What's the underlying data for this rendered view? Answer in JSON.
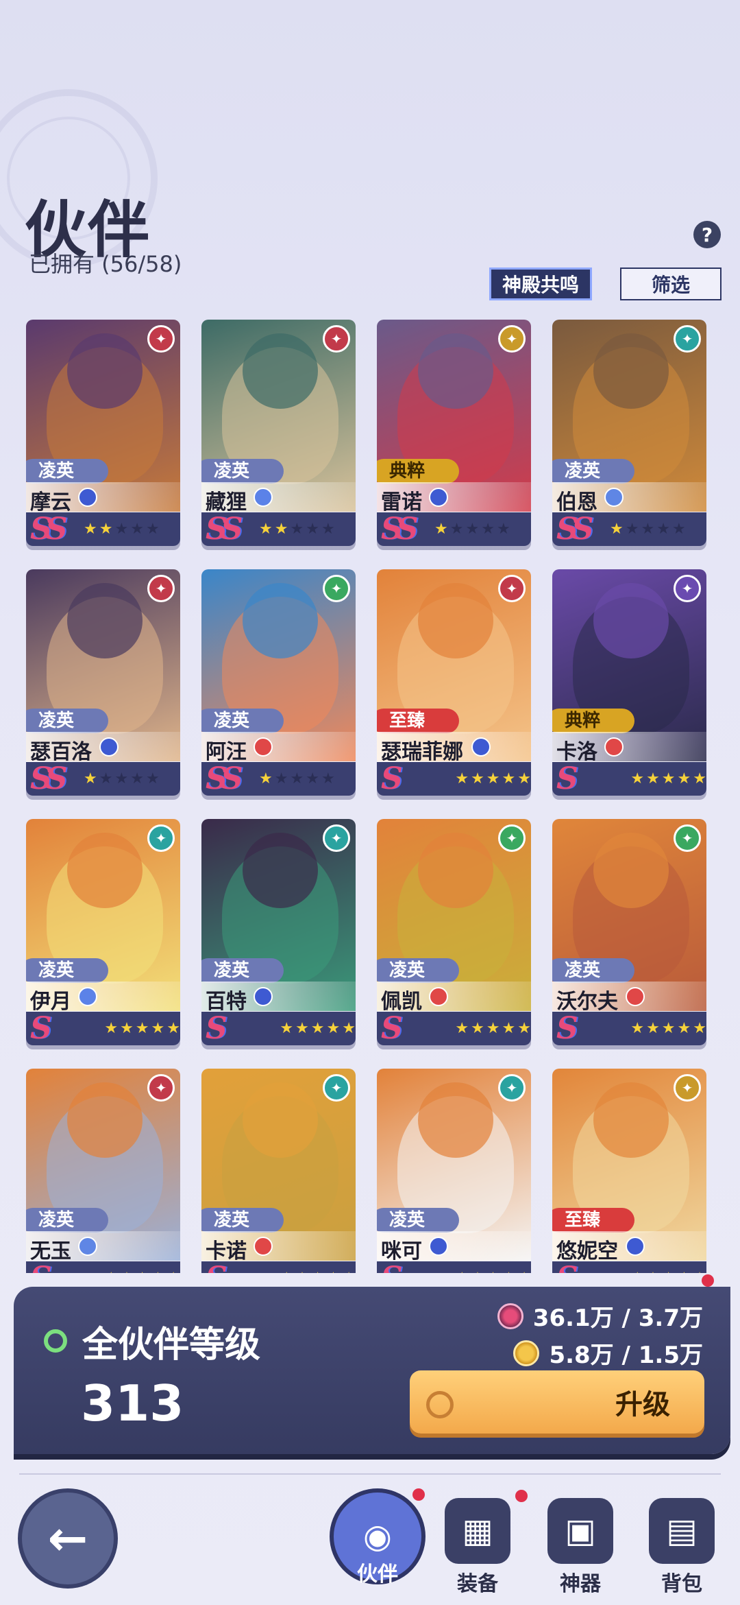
{
  "header": {
    "title": "伙伴",
    "owned_label": "已拥有 (56/58)",
    "help": "?",
    "resonance_button": "神殿共鸣",
    "filter_button": "筛选"
  },
  "partners": [
    {
      "name": "摩云",
      "rarity": "凌英",
      "rarity_class": "r1",
      "grade": "SS",
      "stars": 2,
      "art": [
        "#5a3a6e",
        "#c77a3a"
      ],
      "faction_color": "#c23a4a",
      "class": "c-atk"
    },
    {
      "name": "藏狸",
      "rarity": "凌英",
      "rarity_class": "r1",
      "grade": "SS",
      "stars": 2,
      "art": [
        "#3d6b66",
        "#d9c29a"
      ],
      "faction_color": "#c23a4a",
      "class": "c-heal"
    },
    {
      "name": "雷诺",
      "rarity": "典粹",
      "rarity_class": "r2",
      "grade": "SS",
      "stars": 1,
      "art": [
        "#6a5a8a",
        "#d23b4a"
      ],
      "faction_color": "#c99a2a",
      "class": "c-atk"
    },
    {
      "name": "伯恩",
      "rarity": "凌英",
      "rarity_class": "r1",
      "grade": "SS",
      "stars": 1,
      "art": [
        "#7a5a3e",
        "#d08a3a"
      ],
      "faction_color": "#2aa3a0",
      "class": "c-tank"
    },
    {
      "name": "瑟百洛",
      "rarity": "凌英",
      "rarity_class": "r1",
      "grade": "SS",
      "stars": 1,
      "art": [
        "#4a3a5e",
        "#e0b58a"
      ],
      "faction_color": "#c23a4a",
      "class": "c-atk"
    },
    {
      "name": "阿汪",
      "rarity": "凌英",
      "rarity_class": "r1",
      "grade": "SS",
      "stars": 1,
      "art": [
        "#3a86c9",
        "#f0885a"
      ],
      "faction_color": "#3aa860",
      "class": "c-red"
    },
    {
      "name": "瑟瑞菲娜",
      "rarity": "至臻",
      "rarity_class": "r3",
      "grade": "S",
      "stars": 5,
      "art": [
        "#e2823a",
        "#f4c48a"
      ],
      "faction_color": "#c23a4a",
      "class": "c-atk"
    },
    {
      "name": "卡洛",
      "rarity": "典粹",
      "rarity_class": "r2",
      "grade": "S",
      "stars": 5,
      "art": [
        "#6a4aa8",
        "#2a2a4a"
      ],
      "faction_color": "#6a4ab0",
      "class": "c-red"
    },
    {
      "name": "伊月",
      "rarity": "凌英",
      "rarity_class": "r1",
      "grade": "S",
      "stars": 5,
      "art": [
        "#e2823a",
        "#f2e07a"
      ],
      "faction_color": "#2aa3a0",
      "class": "c-heal"
    },
    {
      "name": "百特",
      "rarity": "凌英",
      "rarity_class": "r1",
      "grade": "S",
      "stars": 5,
      "art": [
        "#3a2a4a",
        "#3a9a7a"
      ],
      "faction_color": "#2aa3a0",
      "class": "c-atk"
    },
    {
      "name": "佩凯",
      "rarity": "凌英",
      "rarity_class": "r1",
      "grade": "S",
      "stars": 5,
      "art": [
        "#e2823a",
        "#c9b03a"
      ],
      "faction_color": "#3aa860",
      "class": "c-red"
    },
    {
      "name": "沃尔夫",
      "rarity": "凌英",
      "rarity_class": "r1",
      "grade": "S",
      "stars": 5,
      "art": [
        "#e0863a",
        "#b85a3a"
      ],
      "faction_color": "#3aa860",
      "class": "c-red"
    },
    {
      "name": "无玉",
      "rarity": "凌英",
      "rarity_class": "r1",
      "grade": "S",
      "stars": 5,
      "art": [
        "#e2823a",
        "#9ab0d8"
      ],
      "faction_color": "#c23a4a",
      "class": "c-tank"
    },
    {
      "name": "卡诺",
      "rarity": "凌英",
      "rarity_class": "r1",
      "grade": "S",
      "stars": 5,
      "art": [
        "#e2a03a",
        "#c9a040"
      ],
      "faction_color": "#2aa3a0",
      "class": "c-red"
    },
    {
      "name": "咪可",
      "rarity": "凌英",
      "rarity_class": "r1",
      "grade": "S",
      "stars": 5,
      "art": [
        "#e2823a",
        "#f4f4f4"
      ],
      "faction_color": "#2aa3a0",
      "class": "c-atk"
    },
    {
      "name": "悠妮空",
      "rarity": "至臻",
      "rarity_class": "r3",
      "grade": "S",
      "stars": 5,
      "art": [
        "#e2863a",
        "#f0d8a0"
      ],
      "faction_color": "#c99a2a",
      "class": "c-atk"
    }
  ],
  "level_panel": {
    "label": "全伙伴等级",
    "level": "313",
    "resource1": "36.1万 / 3.7万",
    "resource2": "5.8万 / 1.5万",
    "upgrade_button": "升级"
  },
  "nav": {
    "back_icon": "back-arrow-icon",
    "items": [
      {
        "label": "伙伴",
        "icon": "partner-icon",
        "active": true
      },
      {
        "label": "装备",
        "icon": "armor-icon",
        "active": false
      },
      {
        "label": "神器",
        "icon": "helmet-icon",
        "active": false
      },
      {
        "label": "背包",
        "icon": "backpack-icon",
        "active": false
      }
    ]
  }
}
